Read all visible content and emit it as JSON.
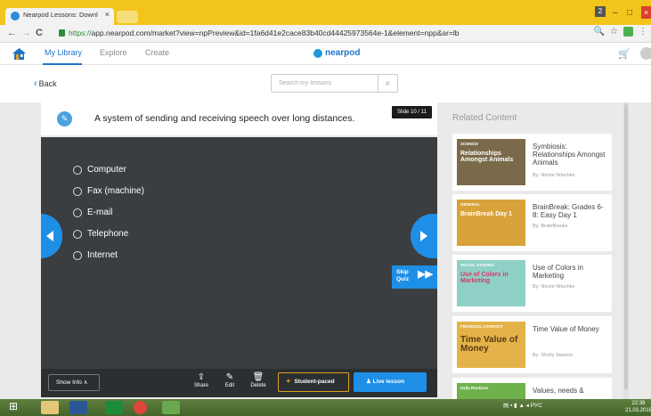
{
  "browser": {
    "tab_title": "Nearpod Lessons: Downl",
    "tab_close": "×",
    "url_scheme": "https://",
    "url_rest": "app.nearpod.com/market?view=npPreview&id=1fa6d41e2cace83b40cd44425973564e-1&element=npp&ar=lb",
    "win_user": "2"
  },
  "topnav": {
    "tabs": [
      "My Library",
      "Explore",
      "Create"
    ],
    "logo_text": "nearpod"
  },
  "subbar": {
    "back_label": "Back",
    "search_placeholder": "Search my lessons"
  },
  "slide": {
    "question": "A system of sending and receiving speech over long distances.",
    "slide_counter": "Slide 10 / 11",
    "options": [
      "Computer",
      "Fax (machine)",
      "E-mail",
      "Telephone",
      "Internet"
    ],
    "skip_label_1": "Skip",
    "skip_label_2": "Quiz"
  },
  "toolbar": {
    "show_info": "Show Info ∧",
    "share": "Share",
    "edit": "Edit",
    "delete": "Delete",
    "student_paced": "Student-paced",
    "live_lesson": "Live lesson"
  },
  "related": {
    "heading": "Related Content",
    "items": [
      {
        "title": "Symbiosis: Relationships Amongst Animals",
        "author": "By: Nicole Nitschke",
        "tag": "SCIENCE",
        "thumb_text": "Relationships Amongst Animals",
        "thumb_color": "#7a6a4a"
      },
      {
        "title": "BrainBreak: Grades 6-8: Easy Day 1",
        "author": "By: BrainBreaks",
        "tag": "GENERAL",
        "thumb_text": "BrainBreak Day 1",
        "thumb_color": "#d9a23a"
      },
      {
        "title": "Use of Colors in Marketing",
        "author": "By: Nicole Nitschke",
        "tag": "SOCIAL STUDIES",
        "thumb_text": "Use of Colors in Marketing",
        "thumb_color": "#8fd0c6"
      },
      {
        "title": "Time Value of Money",
        "author": "By: Shelly Stanton",
        "tag": "FINANCIAL LITERACY",
        "thumb_text": "Time Value of Money",
        "thumb_color": "#e3b34a"
      },
      {
        "title": "Values, needs &",
        "author": "",
        "tag": "Daily Routines",
        "thumb_text": "",
        "thumb_color": "#6fb24b"
      }
    ]
  },
  "taskbar": {
    "lang": "РУС",
    "time": "22:38",
    "date": "21.03.2018"
  }
}
